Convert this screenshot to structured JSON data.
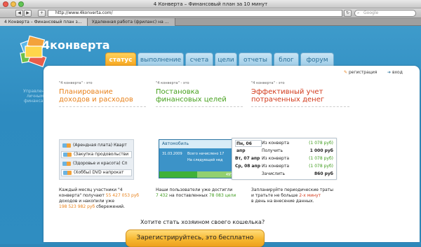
{
  "window": {
    "title": "4 Конверта – Финансовый план за 10 минут"
  },
  "toolbar": {
    "url": "http://www.4konverta.com/",
    "search_placeholder": "Google"
  },
  "browser_tabs": [
    "4 Конверта – Финансовый план з...",
    "Удаленная работа (фриланс) на ..."
  ],
  "site": {
    "logo": "4конверта",
    "sidebar_caption": [
      "Управление",
      "личными",
      "финансами"
    ]
  },
  "nav": [
    "статус",
    "выполнение",
    "счета",
    "цели",
    "отчеты",
    "блог",
    "форум"
  ],
  "auth": {
    "register": "регистрация",
    "login": "вход"
  },
  "columns": [
    {
      "pre": "\"4 конверта\" - это",
      "head1": "Планирование",
      "head2": "доходов и расходов",
      "rows": [
        "(Арендная плата) Кварт",
        "(Закупка продовольстви",
        "(Здоровье и красота) Сп",
        "(Хоббы) DVD напрокат"
      ],
      "desc": [
        "Каждый месяц участники \"4",
        "конверта\" получают",
        "доходов и накопили уже",
        "сбережений."
      ],
      "stat1": "55 427 053 руб",
      "stat2": "198 523 982 руб"
    },
    {
      "pre": "\"4 конверта\" - это",
      "head1": "Постановка",
      "head2": "финансовых целей",
      "car_title": "Автомобиль",
      "car_date": "31.03.2009",
      "car_l1": "Всего начислено 17",
      "car_l2": "На следующей нед",
      "car_progress": 49,
      "car_pct": "49%",
      "desc": [
        "Наши пользователи уже достигли",
        "на поставленных"
      ],
      "stat1": "7 432",
      "stat2": "78 083 цели"
    },
    {
      "pre": "\"4 конверта\" - это",
      "head1": "Эффективный учет",
      "head2": "потраченных денег",
      "ledger": [
        {
          "date": "Пн, 06 апр",
          "what": "Из конверта",
          "amount": "(1 078 руб)"
        },
        {
          "date": "",
          "what": "Получить",
          "amount": "1 000 руб"
        },
        {
          "date": "Вт, 07 апр",
          "what": "Из конверта",
          "amount": "(1 078 руб)"
        },
        {
          "date": "Ср, 08 апр",
          "what": "Из конверта",
          "amount": "(1 078 руб)"
        },
        {
          "date": "",
          "what": "Зачислить",
          "amount": "860 руб"
        }
      ],
      "desc": [
        "Запланируйте периодические траты",
        "и тратьте не больше",
        "в день на внесение данных."
      ],
      "stat1": "2-х минут"
    }
  ],
  "cta": {
    "question": "Хотите стать хозяином своего кошелька?",
    "button": "Зарегистрируйтесь, это бесплатно"
  },
  "colors": {
    "orange": "#e8811a",
    "green": "#45a01c",
    "red": "#d23a1b"
  }
}
